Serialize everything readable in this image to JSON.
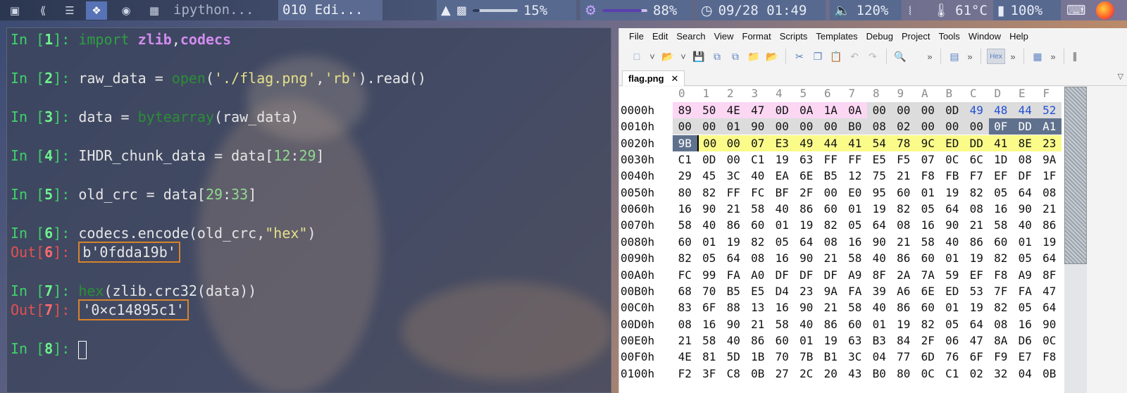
{
  "topbar": {
    "apps": [
      "terminal-icon",
      "vscode-icon",
      "text-editor-icon",
      "pdf-icon",
      "chrome-icon",
      "window-switcher-icon"
    ],
    "tasks": [
      "ipython...",
      "010 Edi..."
    ],
    "brightness": "15%",
    "brightness_fraction": 0.15,
    "cpu": "88%",
    "cpu_fraction": 0.88,
    "clock": "09/28 01:49",
    "volume": "120%",
    "temperature": "61°C",
    "battery": "100%"
  },
  "terminal": {
    "in1_num": "1",
    "in1_code_a": "import",
    "in1_code_b": "zlib",
    "in1_code_c": ",",
    "in1_code_d": "codecs",
    "in2_num": "2",
    "in2_a": "raw_data = ",
    "in2_b": "open",
    "in2_c": "(",
    "in2_d": "'./flag.png'",
    "in2_e": ",",
    "in2_f": "'rb'",
    "in2_g": ").read()",
    "in3_num": "3",
    "in3_a": "data = ",
    "in3_b": "bytearray",
    "in3_c": "(raw_data)",
    "in4_num": "4",
    "in4_a": "IHDR_chunk_data = data[",
    "in4_b": "12",
    "in4_c": ":",
    "in4_d": "29",
    "in4_e": "]",
    "in5_num": "5",
    "in5_a": "old_crc = data[",
    "in5_b": "29",
    "in5_c": ":",
    "in5_d": "33",
    "in5_e": "]",
    "in6_num": "6",
    "in6_a": "codecs.encode(old_crc,",
    "in6_b": "\"hex\"",
    "in6_c": ")",
    "out6_num": "6",
    "out6_val": "b'0fdda19b'",
    "in7_num": "7",
    "in7_a": "hex",
    "in7_b": "(zlib.crc32(data))",
    "out7_num": "7",
    "out7_val": "'0×c14895c1'",
    "in8_num": "8"
  },
  "editor": {
    "menu": [
      "File",
      "Edit",
      "Search",
      "View",
      "Format",
      "Scripts",
      "Templates",
      "Debug",
      "Project",
      "Tools",
      "Window",
      "Help"
    ],
    "tab_name": "flag.png",
    "toolbar_hex_label": "Hex",
    "columns": [
      "0",
      "1",
      "2",
      "3",
      "4",
      "5",
      "6",
      "7",
      "8",
      "9",
      "A",
      "B",
      "C",
      "D",
      "E",
      "F"
    ],
    "rows": [
      {
        "addr": "0000h",
        "bytes": [
          "89",
          "50",
          "4E",
          "47",
          "0D",
          "0A",
          "1A",
          "0A",
          "00",
          "00",
          "00",
          "0D",
          "49",
          "48",
          "44",
          "52"
        ]
      },
      {
        "addr": "0010h",
        "bytes": [
          "00",
          "00",
          "01",
          "90",
          "00",
          "00",
          "00",
          "B0",
          "08",
          "02",
          "00",
          "00",
          "00",
          "0F",
          "DD",
          "A1"
        ]
      },
      {
        "addr": "0020h",
        "bytes": [
          "9B",
          "00",
          "00",
          "07",
          "E3",
          "49",
          "44",
          "41",
          "54",
          "78",
          "9C",
          "ED",
          "DD",
          "41",
          "8E",
          "23"
        ]
      },
      {
        "addr": "0030h",
        "bytes": [
          "C1",
          "0D",
          "00",
          "C1",
          "19",
          "63",
          "FF",
          "FF",
          "E5",
          "F5",
          "07",
          "0C",
          "6C",
          "1D",
          "08",
          "9A"
        ]
      },
      {
        "addr": "0040h",
        "bytes": [
          "29",
          "45",
          "3C",
          "40",
          "EA",
          "6E",
          "B5",
          "12",
          "75",
          "21",
          "F8",
          "FB",
          "F7",
          "EF",
          "DF",
          "1F"
        ]
      },
      {
        "addr": "0050h",
        "bytes": [
          "80",
          "82",
          "FF",
          "FC",
          "BF",
          "2F",
          "00",
          "E0",
          "95",
          "60",
          "01",
          "19",
          "82",
          "05",
          "64",
          "08"
        ]
      },
      {
        "addr": "0060h",
        "bytes": [
          "16",
          "90",
          "21",
          "58",
          "40",
          "86",
          "60",
          "01",
          "19",
          "82",
          "05",
          "64",
          "08",
          "16",
          "90",
          "21"
        ]
      },
      {
        "addr": "0070h",
        "bytes": [
          "58",
          "40",
          "86",
          "60",
          "01",
          "19",
          "82",
          "05",
          "64",
          "08",
          "16",
          "90",
          "21",
          "58",
          "40",
          "86"
        ]
      },
      {
        "addr": "0080h",
        "bytes": [
          "60",
          "01",
          "19",
          "82",
          "05",
          "64",
          "08",
          "16",
          "90",
          "21",
          "58",
          "40",
          "86",
          "60",
          "01",
          "19"
        ]
      },
      {
        "addr": "0090h",
        "bytes": [
          "82",
          "05",
          "64",
          "08",
          "16",
          "90",
          "21",
          "58",
          "40",
          "86",
          "60",
          "01",
          "19",
          "82",
          "05",
          "64"
        ]
      },
      {
        "addr": "00A0h",
        "bytes": [
          "FC",
          "99",
          "FA",
          "A0",
          "DF",
          "DF",
          "DF",
          "A9",
          "8F",
          "2A",
          "7A",
          "59",
          "EF",
          "F8",
          "A9",
          "8F"
        ]
      },
      {
        "addr": "00B0h",
        "bytes": [
          "68",
          "70",
          "B5",
          "E5",
          "D4",
          "23",
          "9A",
          "FA",
          "39",
          "A6",
          "6E",
          "ED",
          "53",
          "7F",
          "FA",
          "47"
        ]
      },
      {
        "addr": "00C0h",
        "bytes": [
          "83",
          "6F",
          "88",
          "13",
          "16",
          "90",
          "21",
          "58",
          "40",
          "86",
          "60",
          "01",
          "19",
          "82",
          "05",
          "64"
        ]
      },
      {
        "addr": "00D0h",
        "bytes": [
          "08",
          "16",
          "90",
          "21",
          "58",
          "40",
          "86",
          "60",
          "01",
          "19",
          "82",
          "05",
          "64",
          "08",
          "16",
          "90"
        ]
      },
      {
        "addr": "00E0h",
        "bytes": [
          "21",
          "58",
          "40",
          "86",
          "60",
          "01",
          "19",
          "63",
          "B3",
          "84",
          "2F",
          "06",
          "47",
          "8A",
          "D6",
          "0C"
        ]
      },
      {
        "addr": "00F0h",
        "bytes": [
          "4E",
          "81",
          "5D",
          "1B",
          "70",
          "7B",
          "B1",
          "3C",
          "04",
          "77",
          "6D",
          "76",
          "6F",
          "F9",
          "E7",
          "F8"
        ]
      },
      {
        "addr": "0100h",
        "bytes": [
          "F2",
          "3F",
          "C8",
          "0B",
          "27",
          "2C",
          "20",
          "43",
          "B0",
          "80",
          "0C",
          "C1",
          "02",
          "32",
          "04",
          "0B"
        ]
      }
    ],
    "colors": {
      "pink": "#fbd7f4",
      "gray": "#dcdcdc",
      "blue_text": "#1f4fd8",
      "selected_bg": "#5f718c",
      "yellow": "#fbfb8a"
    }
  }
}
